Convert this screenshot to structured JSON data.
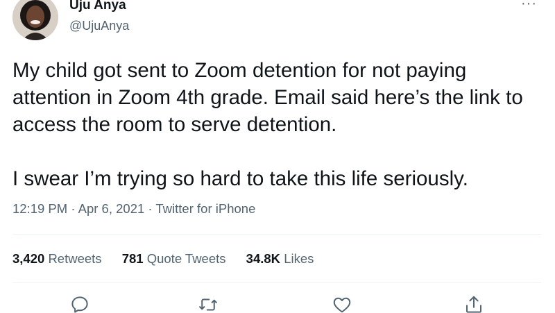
{
  "author": {
    "name": "Uju Anya",
    "handle": "@UjuAnya"
  },
  "more_menu_glyph": "···",
  "tweet": {
    "lines": [
      "My child got sent to Zoom detention for not paying",
      "attention in Zoom 4th grade. Email said here’s the link to",
      "access the room to serve detention.",
      "I swear I’m trying so hard to take this life seriously."
    ]
  },
  "meta": {
    "time": "12:19 PM",
    "separator": "·",
    "date": "Apr 6, 2021",
    "source": "Twitter for iPhone"
  },
  "stats": {
    "retweets_count": "3,420",
    "retweets_label": "Retweets",
    "quotes_count": "781",
    "quotes_label": "Quote Tweets",
    "likes_count": "34.8K",
    "likes_label": "Likes"
  },
  "actions": {
    "reply_icon": "reply-icon",
    "retweet_icon": "retweet-icon",
    "like_icon": "heart-icon",
    "share_icon": "share-icon"
  },
  "colors": {
    "text_primary": "#0f1419",
    "text_secondary": "#536471",
    "divider": "#eff3f4",
    "background": "#ffffff"
  }
}
